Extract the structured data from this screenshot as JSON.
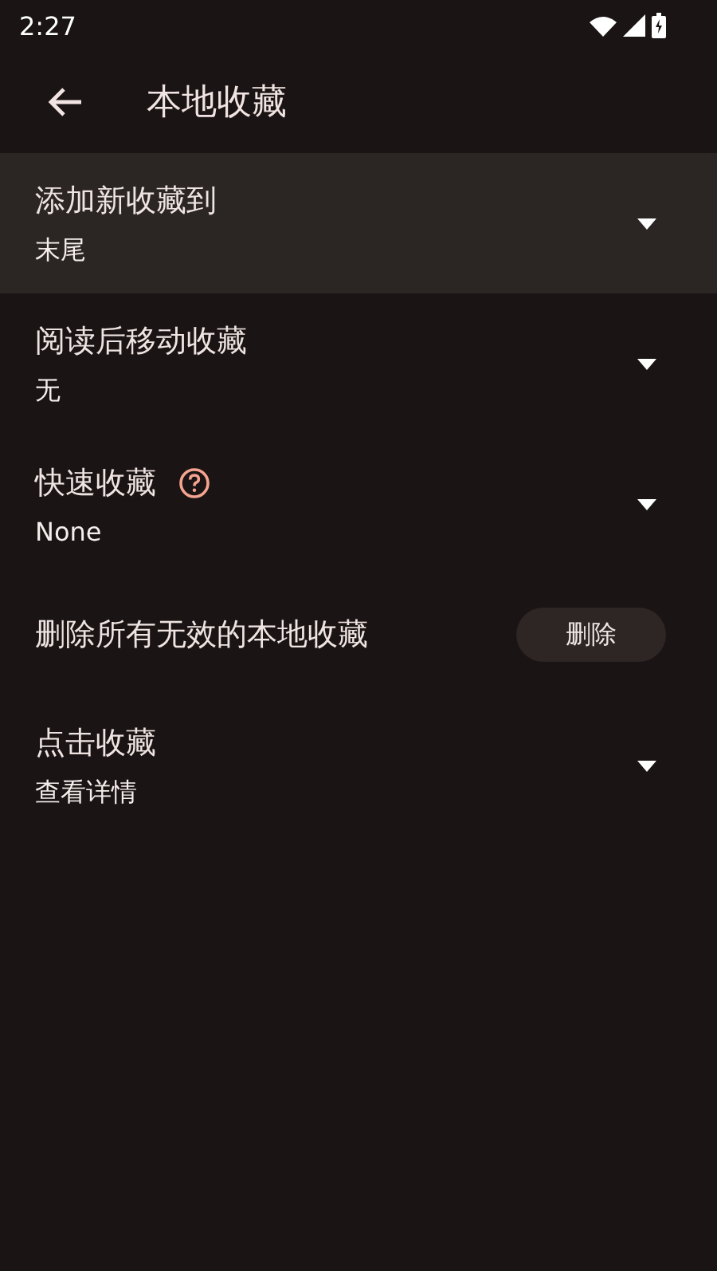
{
  "status_bar": {
    "time": "2:27"
  },
  "app_bar": {
    "title": "本地收藏"
  },
  "settings": [
    {
      "kind": "dropdown",
      "title": "添加新收藏到",
      "value": "末尾",
      "selected": true
    },
    {
      "kind": "dropdown",
      "title": "阅读后移动收藏",
      "value": "无",
      "selected": false
    },
    {
      "kind": "dropdown",
      "title": "快速收藏",
      "value": "None",
      "selected": false,
      "help": true
    },
    {
      "kind": "button",
      "title": "删除所有无效的本地收藏",
      "button": "删除",
      "selected": false
    },
    {
      "kind": "dropdown",
      "title": "点击收藏",
      "value": "查看详情",
      "selected": false
    }
  ]
}
